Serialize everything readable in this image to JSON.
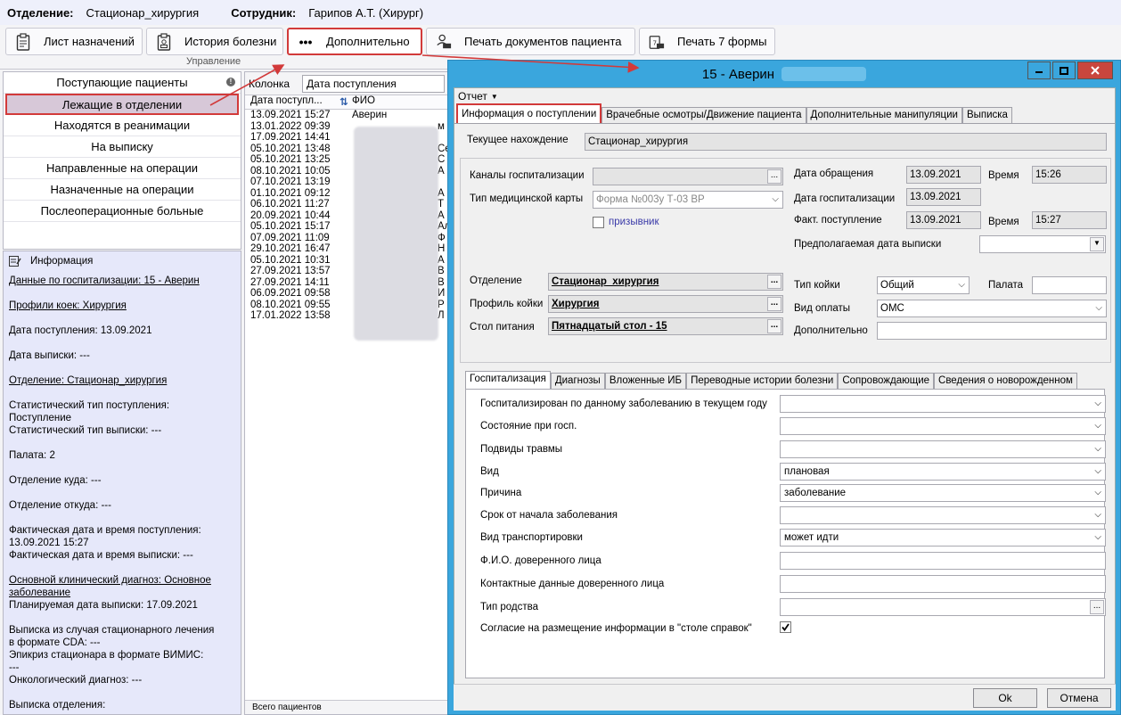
{
  "header": {
    "dept_label": "Отделение:",
    "dept_value": "Стационар_хирургия",
    "emp_label": "Сотрудник:",
    "emp_value": "Гарипов А.Т. (Хирург)"
  },
  "toolbar": {
    "btn1": "Лист назначений",
    "btn2": "История болезни",
    "btn3": "Дополнительно",
    "btn4": "Печать документов пациента",
    "btn5": "Печать 7 формы",
    "group_label": "Управление"
  },
  "nav": {
    "items": [
      "Поступающие пациенты",
      "Лежащие в отделении",
      "Находятся в реанимации",
      "На выписку",
      "Направленные на операции",
      "Назначенные на операции",
      "Послеоперационные больные"
    ],
    "info_dot": "!"
  },
  "info": {
    "title": "Информация",
    "l1": "Данные по госпитализации: 15 - Аверин",
    "l2": "Профили коек: Хирургия",
    "l3": "Дата поступления: 13.09.2021",
    "l4": "Дата выписки: ---",
    "l5": "Отделение: Стационар_хирургия",
    "l6a": "Статистический тип поступления:",
    "l6b": "Поступление",
    "l6c": "Статистический тип выписки: ---",
    "l7": "Палата: 2",
    "l8": "Отделение куда: ---",
    "l9": "Отделение откуда: ---",
    "l10a": "Фактическая дата и время поступления:",
    "l10b": "13.09.2021 15:27",
    "l10c": "Фактическая дата и время выписки: ---",
    "l11a": "Основной клинический диагноз: Основное",
    "l11b": "заболевание",
    "l11c": "Планируемая дата выписки: 17.09.2021",
    "l12a": "Выписка из случая стационарного лечения",
    "l12b": "в формате CDA: ---",
    "l12c": "Эпикриз стационара в формате ВИМИС:",
    "l12d": "---",
    "l12e": "Онкологический диагноз: ---",
    "l13": "Выписка отделения:"
  },
  "list": {
    "filter_label": "Колонка",
    "filter_value": "Дата поступления",
    "col1": "Дата поступл...",
    "col2": "ФИО",
    "rows": [
      [
        "13.09.2021 15:27",
        "Аверин"
      ],
      [
        "13.01.2022 09:39",
        ""
      ],
      [
        "17.09.2021 14:41",
        ""
      ],
      [
        "05.10.2021 13:48",
        ""
      ],
      [
        "05.10.2021 13:25",
        ""
      ],
      [
        "08.10.2021 10:05",
        ""
      ],
      [
        "07.10.2021 13:19",
        ""
      ],
      [
        "01.10.2021 09:12",
        ""
      ],
      [
        "06.10.2021 11:27",
        ""
      ],
      [
        "20.09.2021 10:44",
        ""
      ],
      [
        "05.10.2021 15:17",
        ""
      ],
      [
        "07.09.2021 11:09",
        ""
      ],
      [
        "29.10.2021 16:47",
        ""
      ],
      [
        "05.10.2021 10:31",
        ""
      ],
      [
        "27.09.2021 13:57",
        ""
      ],
      [
        "27.09.2021 14:11",
        ""
      ],
      [
        "06.09.2021 09:58",
        ""
      ],
      [
        "08.10.2021 09:55",
        ""
      ],
      [
        "17.01.2022 13:58",
        ""
      ]
    ],
    "edge_letters": [
      "",
      "м",
      "",
      "Се",
      "С",
      "А",
      "",
      "А",
      "Т",
      "А",
      "Ал",
      "Ф",
      "Н",
      "А",
      "В",
      "В",
      "И",
      "Р",
      "Л"
    ],
    "footer": "Всего пациентов"
  },
  "modal": {
    "title": "15 - Аверин",
    "menu": "Отчет",
    "tabs": [
      "Информация о поступлении",
      "Врачебные осмотры/Движение пациента",
      "Дополнительные манипуляции",
      "Выписка"
    ],
    "current_label": "Текущее нахождение",
    "current_value": "Стационар_хирургия",
    "channels_label": "Каналы госпитализации",
    "cardtype_label": "Тип медицинской карты",
    "cardtype_value": "Форма №003у Т-03 ВР",
    "conscript_label": "призывник",
    "appeal_date_label": "Дата обращения",
    "appeal_date": "13.09.2021",
    "time_label": "Время",
    "appeal_time": "15:26",
    "hosp_date_label": "Дата госпитализации",
    "hosp_date": "13.09.2021",
    "fact_label": "Факт. поступление",
    "fact_date": "13.09.2021",
    "fact_time": "15:27",
    "discharge_label": "Предполагаемая дата выписки",
    "dept_label": "Отделение",
    "dept_value": "Стационар_хирургия",
    "bed_profile_label": "Профиль койки",
    "bed_profile_value": "Хирургия",
    "diet_label": "Стол питания",
    "diet_value": "Пятнадцатый стол - 15",
    "bed_type_label": "Тип койки",
    "bed_type_value": "Общий",
    "ward_label": "Палата",
    "pay_label": "Вид оплаты",
    "pay_value": "ОМС",
    "extra_label": "Дополнительно",
    "subtabs": [
      "Госпитализация",
      "Диагнозы",
      "Вложенные ИБ",
      "Переводные истории болезни",
      "Сопровождающие",
      "Сведения о новорожденном"
    ],
    "rows": [
      {
        "label": "Госпитализирован по данному заболеванию в текущем году",
        "value": ""
      },
      {
        "label": "Состояние при госп.",
        "value": ""
      },
      {
        "label": "Подвиды травмы",
        "value": ""
      },
      {
        "label": "Вид",
        "value": "плановая"
      },
      {
        "label": "Причина",
        "value": "заболевание"
      },
      {
        "label": "Срок от начала заболевания",
        "value": ""
      },
      {
        "label": "Вид транспортировки",
        "value": "может идти"
      },
      {
        "label": "Ф.И.О. доверенного лица",
        "value": ""
      },
      {
        "label": "Контактные данные доверенного лица",
        "value": ""
      },
      {
        "label": "Тип родства",
        "value": ""
      }
    ],
    "consent_label": "Согласие на размещение информации в \"столе справок\"",
    "ok": "Ok",
    "cancel": "Отмена"
  }
}
